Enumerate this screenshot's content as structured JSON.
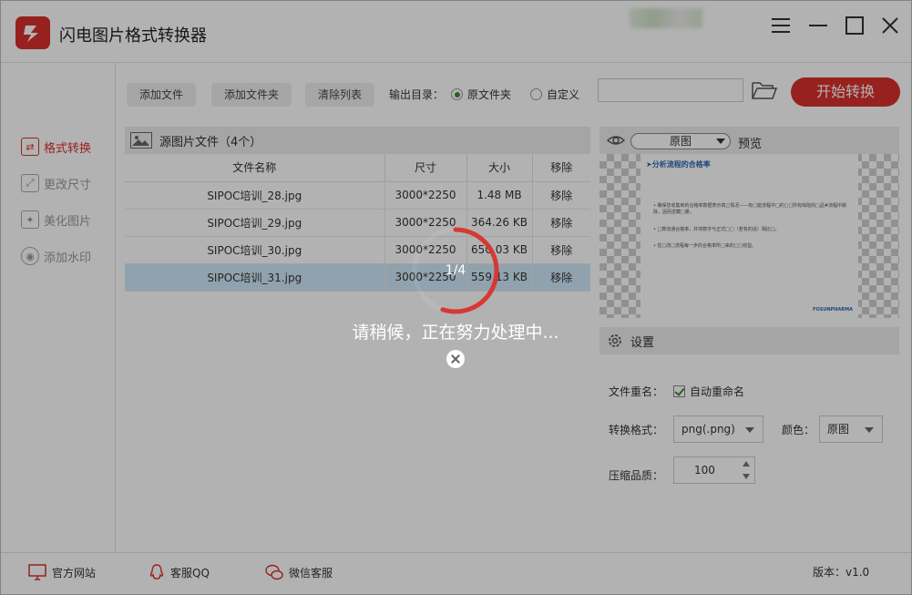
{
  "app": {
    "title": "闪电图片格式转换器"
  },
  "sidebar": {
    "items": [
      {
        "label": "格式转换",
        "icon": "convert-icon",
        "active": true
      },
      {
        "label": "更改尺寸",
        "icon": "resize-icon",
        "active": false
      },
      {
        "label": "美化图片",
        "icon": "beautify-icon",
        "active": false
      },
      {
        "label": "添加水印",
        "icon": "watermark-icon",
        "active": false
      }
    ]
  },
  "toolbar": {
    "add_file": "添加文件",
    "add_folder": "添加文件夹",
    "clear_list": "清除列表",
    "output_label": "输出目录：",
    "radio_original": "原文件夹",
    "radio_custom": "自定义",
    "path_value": "",
    "start_label": "开始转换"
  },
  "files": {
    "header": "源图片文件（4个）",
    "columns": [
      "文件名称",
      "尺寸",
      "大小",
      "移除"
    ],
    "rows": [
      {
        "name": "SIPOC培训_28.jpg",
        "dims": "3000*2250",
        "size": "1.48 MB",
        "remove": "移除"
      },
      {
        "name": "SIPOC培训_29.jpg",
        "dims": "3000*2250",
        "size": "364.26 KB",
        "remove": "移除"
      },
      {
        "name": "SIPOC培训_30.jpg",
        "dims": "3000*2250",
        "size": "650.03 KB",
        "remove": "移除"
      },
      {
        "name": "SIPOC培训_31.jpg",
        "dims": "3000*2250",
        "size": "559.13 KB",
        "remove": "移除"
      }
    ]
  },
  "preview": {
    "mode": "原图",
    "label": "预览",
    "slide_title": "➤分析流程的合格率",
    "slide_lines": [
      "• 确保您收集到的合格率数据表示真□情况——有□能流程中□的□□所有缺陷的□品#流程中剔除，因而逻藏□量。",
      "• □算流通合格率，并将数字与正式□□（若有的话）相比□。",
      "• 估□改□流程每一步的合格率所□来的□□收益。"
    ],
    "slide_logo": "FOSUNPHARMA"
  },
  "settings": {
    "title": "设置",
    "rename_label": "文件重名：",
    "rename_checkbox": "自动重命名",
    "format_label": "转换格式：",
    "format_value": "png(.png)",
    "color_label": "颜色：",
    "color_value": "原图",
    "quality_label": "压缩品质：",
    "quality_value": "100"
  },
  "footer": {
    "website": "官方网站",
    "qq": "客服QQ",
    "wechat": "微信客服",
    "version": "版本：v1.0"
  },
  "overlay": {
    "progress": "1/4",
    "progress_fraction": 0.25,
    "message": "请稍候，正在努力处理中..."
  },
  "colors": {
    "accent": "#d9302c",
    "selected_row": "#cfe8f8",
    "check": "#3a8a3a"
  }
}
